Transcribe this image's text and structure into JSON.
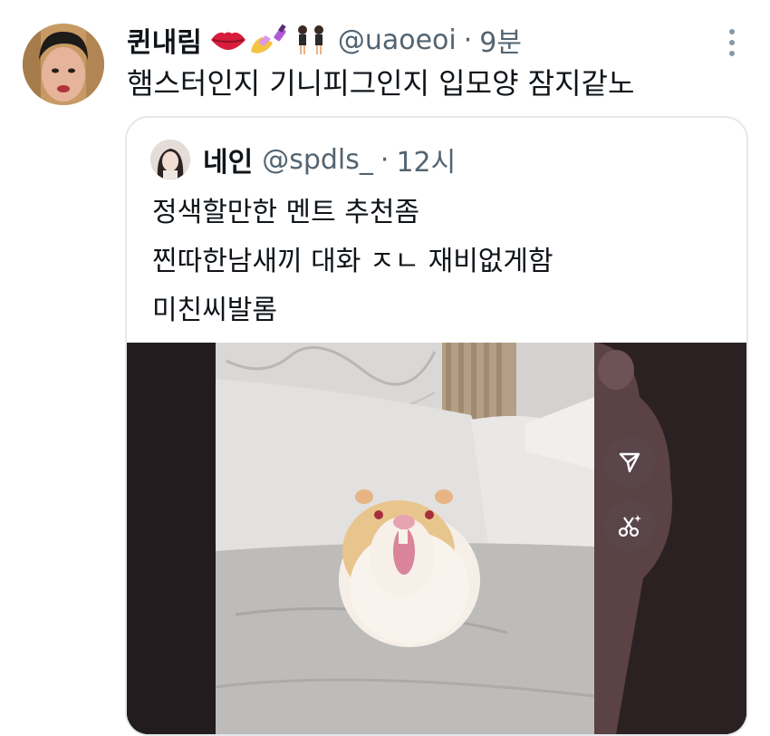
{
  "tweet": {
    "display_name": "퀸내림",
    "emojis": [
      "lips-emoji",
      "nail-polish-emoji",
      "dancers-emoji"
    ],
    "handle": "@uaoeoi",
    "separator": "·",
    "time": "9분",
    "text": "햄스터인지 기니피그인지 입모양 잠지같노"
  },
  "quote": {
    "display_name": "네인",
    "handle": "@spdls_",
    "separator": "·",
    "time": "12시",
    "lines": [
      "정색할만한 멘트 추천좀",
      "찐따한남새끼 대화 ㅈㄴ 재비없게함",
      "미친씨발롬"
    ]
  },
  "media_buttons": [
    "send-icon",
    "scissors-sparkle-icon"
  ],
  "colors": {
    "text_primary": "#0f1419",
    "text_secondary": "#536471",
    "card_border": "#e4e8ec",
    "media_bg": "#231c1e"
  }
}
